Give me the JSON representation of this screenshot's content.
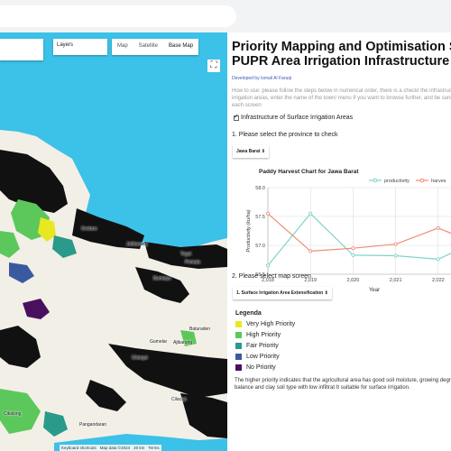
{
  "map": {
    "layers_label": "Layers",
    "map_types": [
      "Map",
      "Satellite",
      "Base Map"
    ],
    "active_map_type": "Base Map",
    "place_labels": [
      "Cirebon",
      "Tegal",
      "Bumiayu",
      "Ajibarang",
      "Gumelar",
      "Baturaden",
      "Cilacap",
      "Cikalong",
      "Pangandaran",
      "Jatibarang",
      "Cilangsi",
      "Pemala"
    ],
    "attribution": [
      "Keyboard shortcuts",
      "Map data ©2024",
      "20 km",
      "Terms"
    ]
  },
  "panel": {
    "title_line1": "Priority Mapping and Optimisation S",
    "title_line2": "PUPR Area Irrigation Infrastructure",
    "developer": "Developed by Ismail Al Faruqi",
    "howto": "How to use: please follow the steps below in numerical order, there is a checkl the infrastructure map of surface irrigation areas, enter the name of the town/ menu if you want to browse further, and be sure to double click on each screen",
    "checkbox_label": "Infrastructure of Surface Irrigation Areas",
    "step1": "1. Please select the province to check",
    "province_value": "Jawa Barat",
    "step2": "2. Please select map screen",
    "screen_value": "1. Surface Irrigation Area Extensification",
    "legend_title": "Legenda",
    "legend": [
      {
        "label": "Very High Priority",
        "color": "#e8e822"
      },
      {
        "label": "High Priority",
        "color": "#5cc85c"
      },
      {
        "label": "Fair Priority",
        "color": "#2a9a8a"
      },
      {
        "label": "Low Priority",
        "color": "#3a5aa0"
      },
      {
        "label": "No Priority",
        "color": "#4a1060"
      }
    ],
    "description": "The higher priority indicates that the agricultural area has good soil moisture, growing degree day, surplus water balance and clay soil type with low infiltrat It suitable for surface irrigation."
  },
  "chart_data": {
    "type": "line",
    "title": "Paddy Harvest Chart for Jawa Barat",
    "xlabel": "Year",
    "ylabel": "Productivity (ku/ha)",
    "x": [
      2018,
      2019,
      2020,
      2021,
      2022,
      2023
    ],
    "x_tick_labels": [
      "2,018",
      "2,019",
      "2,020",
      "2,021",
      "2,022"
    ],
    "y_ticks": [
      "58.0",
      "57.5",
      "57.0",
      "56.5"
    ],
    "ylim": [
      56.5,
      58.0
    ],
    "legend_position": "top-right",
    "series": [
      {
        "name": "productivity",
        "color": "#7fd3c8",
        "values": [
          56.65,
          57.55,
          56.83,
          56.82,
          56.76,
          57.1
        ]
      },
      {
        "name": "harves",
        "color": "#f28b78",
        "values": [
          57.55,
          56.9,
          56.95,
          57.02,
          57.3,
          57.0
        ]
      }
    ]
  }
}
